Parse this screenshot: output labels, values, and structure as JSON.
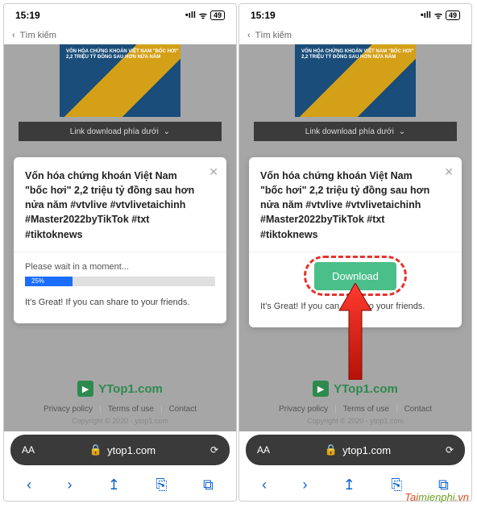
{
  "status": {
    "time": "15:19",
    "signal": "•ıll",
    "wifi": "⋮",
    "battery": "49"
  },
  "search": {
    "placeholder": "Tìm kiếm"
  },
  "bg_banner": "VỐN HÓA CHỨNG KHOÁN VIỆT NAM \"BỐC HƠI\" 2,2 TRIỆU TỶ ĐỒNG SAU HƠN NỬA NĂM",
  "link_banner": "Link download phía dưới",
  "popup": {
    "title": "Vốn hóa chứng khoán Việt Nam \"bốc hơi\" 2,2 triệu tỷ đồng sau hơn nửa năm #vtvlive #vtvlivetaichinh #Master2022byTikTok #txt #tiktoknews",
    "close": "✕",
    "wait": "Please wait in a moment...",
    "progress_pct": "25%",
    "download": "Download",
    "share": "It's Great! If you can share to your friends."
  },
  "logo": {
    "name": "YTop1.com",
    "icon": "▶"
  },
  "footer_links": {
    "privacy": "Privacy policy",
    "terms": "Terms of use",
    "contact": "Contact"
  },
  "copyright": "Copyright © 2020 - ytop1.com",
  "browser": {
    "aa": "AA",
    "lock": "🔒",
    "domain": "ytop1.com",
    "reload": "⟳"
  },
  "toolbar": {
    "back": "‹",
    "forward": "›",
    "share": "↥",
    "bookmarks": "⎘",
    "tabs": "⧉"
  },
  "watermark": {
    "t": "Tai",
    "m": "mienphi",
    "suffix": ".vn"
  }
}
